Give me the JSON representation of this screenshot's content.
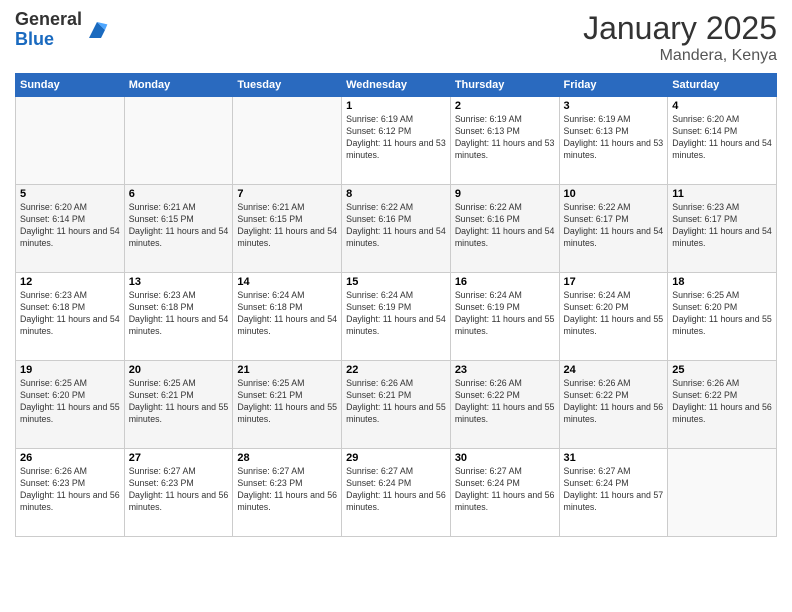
{
  "header": {
    "logo_line1": "General",
    "logo_line2": "Blue",
    "month": "January 2025",
    "location": "Mandera, Kenya"
  },
  "days_of_week": [
    "Sunday",
    "Monday",
    "Tuesday",
    "Wednesday",
    "Thursday",
    "Friday",
    "Saturday"
  ],
  "weeks": [
    [
      {
        "day": "",
        "sunrise": "",
        "sunset": "",
        "daylight": ""
      },
      {
        "day": "",
        "sunrise": "",
        "sunset": "",
        "daylight": ""
      },
      {
        "day": "",
        "sunrise": "",
        "sunset": "",
        "daylight": ""
      },
      {
        "day": "1",
        "sunrise": "Sunrise: 6:19 AM",
        "sunset": "Sunset: 6:12 PM",
        "daylight": "Daylight: 11 hours and 53 minutes."
      },
      {
        "day": "2",
        "sunrise": "Sunrise: 6:19 AM",
        "sunset": "Sunset: 6:13 PM",
        "daylight": "Daylight: 11 hours and 53 minutes."
      },
      {
        "day": "3",
        "sunrise": "Sunrise: 6:19 AM",
        "sunset": "Sunset: 6:13 PM",
        "daylight": "Daylight: 11 hours and 53 minutes."
      },
      {
        "day": "4",
        "sunrise": "Sunrise: 6:20 AM",
        "sunset": "Sunset: 6:14 PM",
        "daylight": "Daylight: 11 hours and 54 minutes."
      }
    ],
    [
      {
        "day": "5",
        "sunrise": "Sunrise: 6:20 AM",
        "sunset": "Sunset: 6:14 PM",
        "daylight": "Daylight: 11 hours and 54 minutes."
      },
      {
        "day": "6",
        "sunrise": "Sunrise: 6:21 AM",
        "sunset": "Sunset: 6:15 PM",
        "daylight": "Daylight: 11 hours and 54 minutes."
      },
      {
        "day": "7",
        "sunrise": "Sunrise: 6:21 AM",
        "sunset": "Sunset: 6:15 PM",
        "daylight": "Daylight: 11 hours and 54 minutes."
      },
      {
        "day": "8",
        "sunrise": "Sunrise: 6:22 AM",
        "sunset": "Sunset: 6:16 PM",
        "daylight": "Daylight: 11 hours and 54 minutes."
      },
      {
        "day": "9",
        "sunrise": "Sunrise: 6:22 AM",
        "sunset": "Sunset: 6:16 PM",
        "daylight": "Daylight: 11 hours and 54 minutes."
      },
      {
        "day": "10",
        "sunrise": "Sunrise: 6:22 AM",
        "sunset": "Sunset: 6:17 PM",
        "daylight": "Daylight: 11 hours and 54 minutes."
      },
      {
        "day": "11",
        "sunrise": "Sunrise: 6:23 AM",
        "sunset": "Sunset: 6:17 PM",
        "daylight": "Daylight: 11 hours and 54 minutes."
      }
    ],
    [
      {
        "day": "12",
        "sunrise": "Sunrise: 6:23 AM",
        "sunset": "Sunset: 6:18 PM",
        "daylight": "Daylight: 11 hours and 54 minutes."
      },
      {
        "day": "13",
        "sunrise": "Sunrise: 6:23 AM",
        "sunset": "Sunset: 6:18 PM",
        "daylight": "Daylight: 11 hours and 54 minutes."
      },
      {
        "day": "14",
        "sunrise": "Sunrise: 6:24 AM",
        "sunset": "Sunset: 6:18 PM",
        "daylight": "Daylight: 11 hours and 54 minutes."
      },
      {
        "day": "15",
        "sunrise": "Sunrise: 6:24 AM",
        "sunset": "Sunset: 6:19 PM",
        "daylight": "Daylight: 11 hours and 54 minutes."
      },
      {
        "day": "16",
        "sunrise": "Sunrise: 6:24 AM",
        "sunset": "Sunset: 6:19 PM",
        "daylight": "Daylight: 11 hours and 55 minutes."
      },
      {
        "day": "17",
        "sunrise": "Sunrise: 6:24 AM",
        "sunset": "Sunset: 6:20 PM",
        "daylight": "Daylight: 11 hours and 55 minutes."
      },
      {
        "day": "18",
        "sunrise": "Sunrise: 6:25 AM",
        "sunset": "Sunset: 6:20 PM",
        "daylight": "Daylight: 11 hours and 55 minutes."
      }
    ],
    [
      {
        "day": "19",
        "sunrise": "Sunrise: 6:25 AM",
        "sunset": "Sunset: 6:20 PM",
        "daylight": "Daylight: 11 hours and 55 minutes."
      },
      {
        "day": "20",
        "sunrise": "Sunrise: 6:25 AM",
        "sunset": "Sunset: 6:21 PM",
        "daylight": "Daylight: 11 hours and 55 minutes."
      },
      {
        "day": "21",
        "sunrise": "Sunrise: 6:25 AM",
        "sunset": "Sunset: 6:21 PM",
        "daylight": "Daylight: 11 hours and 55 minutes."
      },
      {
        "day": "22",
        "sunrise": "Sunrise: 6:26 AM",
        "sunset": "Sunset: 6:21 PM",
        "daylight": "Daylight: 11 hours and 55 minutes."
      },
      {
        "day": "23",
        "sunrise": "Sunrise: 6:26 AM",
        "sunset": "Sunset: 6:22 PM",
        "daylight": "Daylight: 11 hours and 55 minutes."
      },
      {
        "day": "24",
        "sunrise": "Sunrise: 6:26 AM",
        "sunset": "Sunset: 6:22 PM",
        "daylight": "Daylight: 11 hours and 56 minutes."
      },
      {
        "day": "25",
        "sunrise": "Sunrise: 6:26 AM",
        "sunset": "Sunset: 6:22 PM",
        "daylight": "Daylight: 11 hours and 56 minutes."
      }
    ],
    [
      {
        "day": "26",
        "sunrise": "Sunrise: 6:26 AM",
        "sunset": "Sunset: 6:23 PM",
        "daylight": "Daylight: 11 hours and 56 minutes."
      },
      {
        "day": "27",
        "sunrise": "Sunrise: 6:27 AM",
        "sunset": "Sunset: 6:23 PM",
        "daylight": "Daylight: 11 hours and 56 minutes."
      },
      {
        "day": "28",
        "sunrise": "Sunrise: 6:27 AM",
        "sunset": "Sunset: 6:23 PM",
        "daylight": "Daylight: 11 hours and 56 minutes."
      },
      {
        "day": "29",
        "sunrise": "Sunrise: 6:27 AM",
        "sunset": "Sunset: 6:24 PM",
        "daylight": "Daylight: 11 hours and 56 minutes."
      },
      {
        "day": "30",
        "sunrise": "Sunrise: 6:27 AM",
        "sunset": "Sunset: 6:24 PM",
        "daylight": "Daylight: 11 hours and 56 minutes."
      },
      {
        "day": "31",
        "sunrise": "Sunrise: 6:27 AM",
        "sunset": "Sunset: 6:24 PM",
        "daylight": "Daylight: 11 hours and 57 minutes."
      },
      {
        "day": "",
        "sunrise": "",
        "sunset": "",
        "daylight": ""
      }
    ]
  ]
}
